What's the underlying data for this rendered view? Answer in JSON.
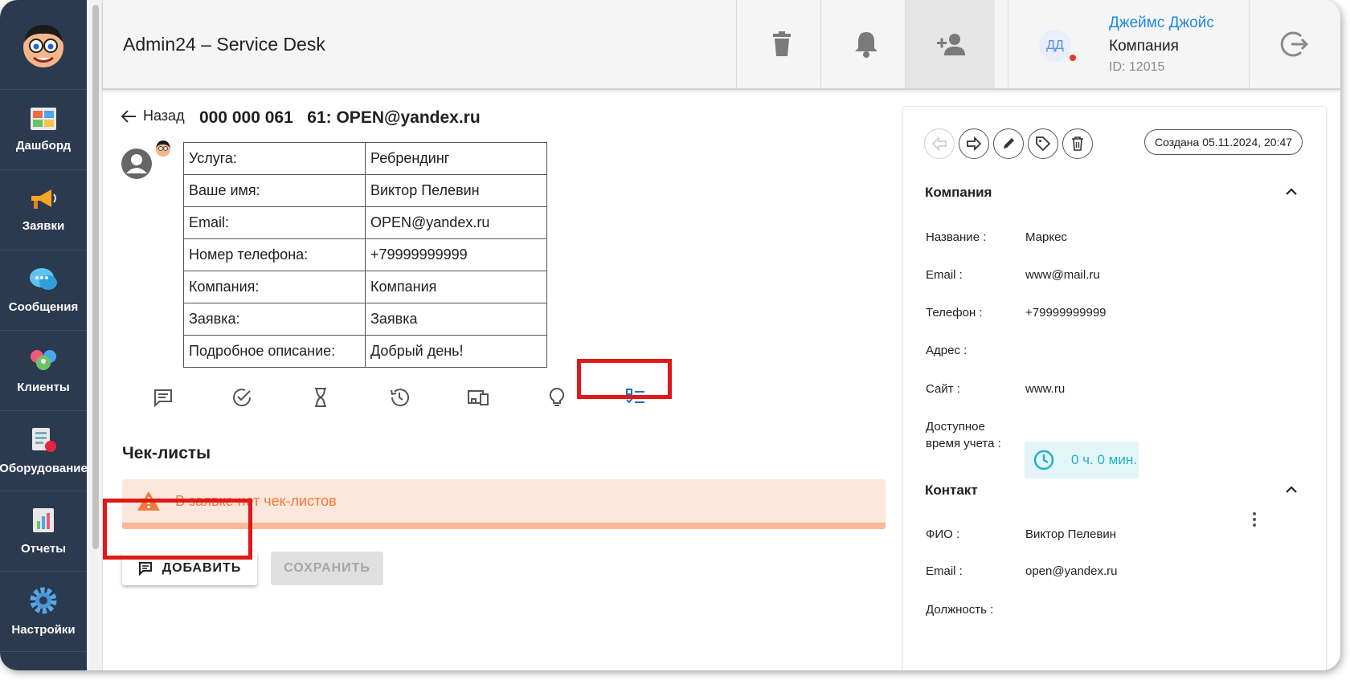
{
  "app": {
    "title": "Admin24 – Service Desk"
  },
  "sidebar": {
    "items": [
      {
        "label": "Дашборд",
        "icon": "dashboard-icon"
      },
      {
        "label": "Заявки",
        "icon": "megaphone-icon"
      },
      {
        "label": "Сообщения",
        "icon": "chat-bubble-icon"
      },
      {
        "label": "Клиенты",
        "icon": "clients-icon"
      },
      {
        "label": "Оборудование",
        "icon": "equipment-icon"
      },
      {
        "label": "Отчеты",
        "icon": "report-icon"
      },
      {
        "label": "Настройки",
        "icon": "settings-gear-icon"
      }
    ]
  },
  "header": {
    "user": {
      "initials": "ДД",
      "name": "Джеймс Джойс",
      "company": "Компания",
      "id": "ID: 12015"
    }
  },
  "ticket": {
    "back_label": "Назад",
    "title": "000 000 061   61: OPEN@yandex.ru",
    "fields": [
      {
        "key": "Услуга:",
        "value": "Ребрендинг"
      },
      {
        "key": "Ваше имя:",
        "value": "Виктор Пелевин"
      },
      {
        "key": "Email:",
        "value": "OPEN@yandex.ru"
      },
      {
        "key": "Номер телефона:",
        "value": "+79999999999"
      },
      {
        "key": "Компания:",
        "value": "Компания"
      },
      {
        "key": "Заявка:",
        "value": "Заявка"
      },
      {
        "key": "Подробное описание:",
        "value": "Добрый день!"
      }
    ],
    "tabs": [
      "comments-icon",
      "check-circle-icon",
      "hourglass-icon",
      "history-icon",
      "devices-icon",
      "lightbulb-icon",
      "checklist-icon"
    ],
    "active_tab": "checklist-icon"
  },
  "checklists": {
    "title": "Чек-листы",
    "empty_message": "В заявке нет чек-листов",
    "add_label": "ДОБАВИТЬ",
    "save_label": "СОХРАНИТЬ"
  },
  "details": {
    "created": "Создана 05.11.2024, 20:47",
    "company_section": {
      "title": "Компания",
      "fields": [
        {
          "key": "Название :",
          "value": "Маркес"
        },
        {
          "key": "Email :",
          "value": "www@mail.ru"
        },
        {
          "key": "Телефон :",
          "value": "+79999999999"
        },
        {
          "key": "Адрес :",
          "value": ""
        },
        {
          "key": "Сайт :",
          "value": "www.ru"
        }
      ],
      "time_label_1": "Доступное",
      "time_label_2": "время учета :",
      "time_value": "0 ч. 0 мин."
    },
    "contact_section": {
      "title": "Контакт",
      "fields": [
        {
          "key": "ФИО :",
          "value": "Виктор Пелевин"
        },
        {
          "key": "Email :",
          "value": "open@yandex.ru"
        },
        {
          "key": "Должность :",
          "value": ""
        }
      ]
    }
  },
  "colors": {
    "sidebar": "#2b3a4e",
    "accent": "#1e88e5",
    "highlight": "#e01818",
    "warning": "#f27a3a",
    "teal": "#26b0c7"
  }
}
